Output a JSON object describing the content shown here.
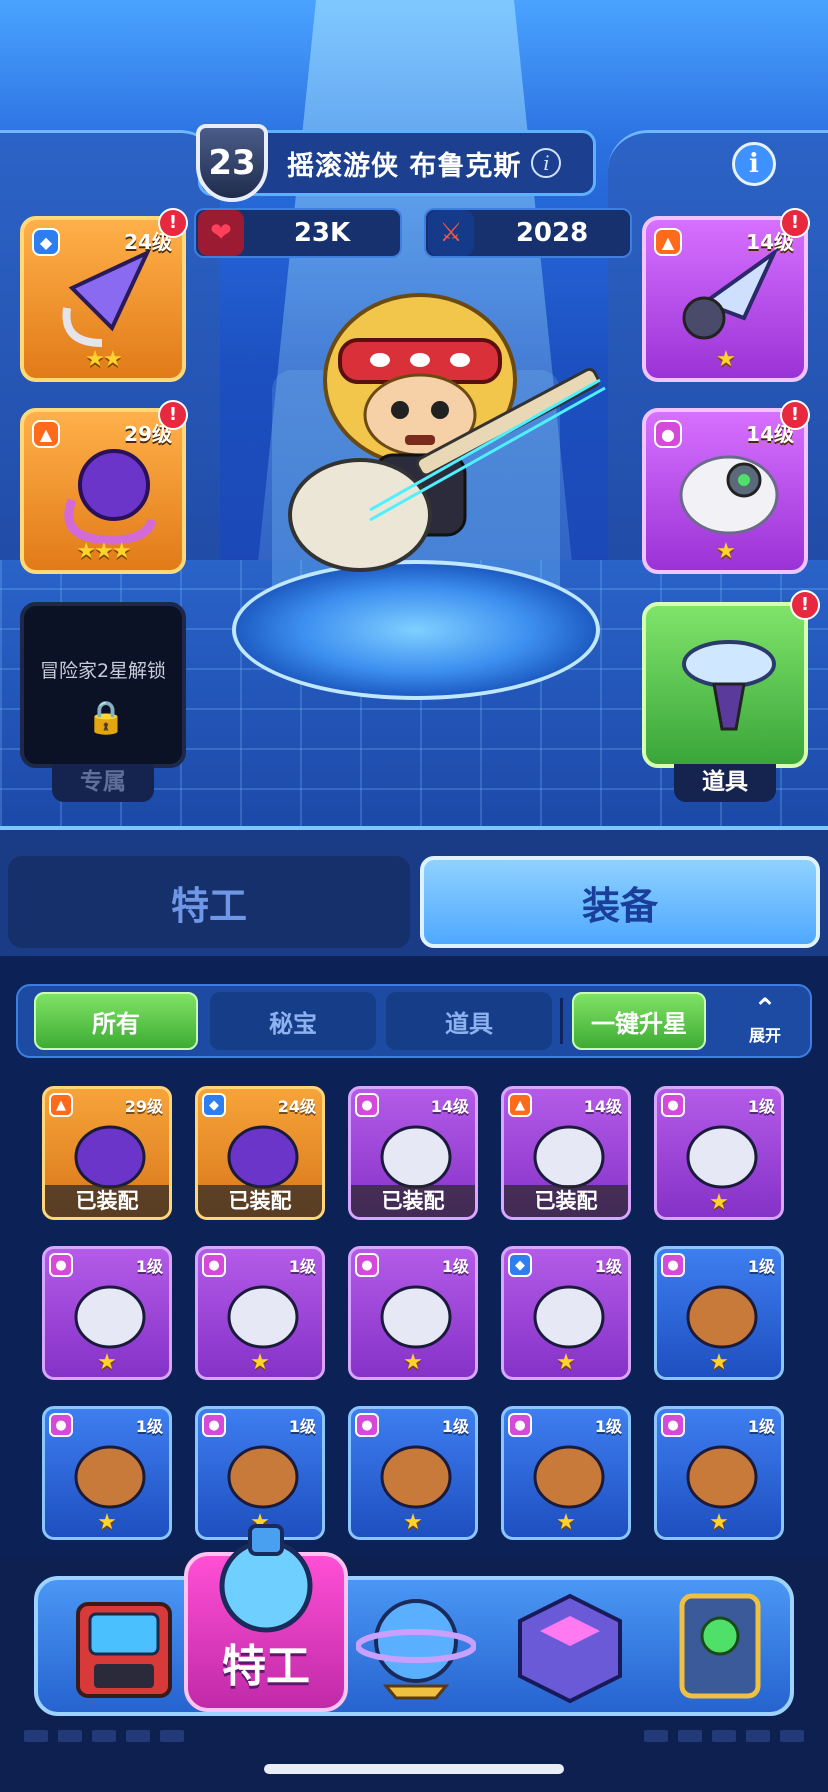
{
  "hero": {
    "level": "23",
    "name": "摇滚游侠 布鲁克斯",
    "hp": "23K",
    "attack": "2028"
  },
  "slots": {
    "left": [
      {
        "level": "24级",
        "stars": "★★",
        "badge": "shield-icon",
        "rarity": "orange"
      },
      {
        "level": "29级",
        "stars": "★★★",
        "badge": "fire-icon",
        "rarity": "orange"
      }
    ],
    "locked": {
      "text": "冒险家2星解锁",
      "caption": "专属"
    },
    "right": [
      {
        "level": "14级",
        "stars": "★",
        "badge": "fire-icon",
        "rarity": "purple"
      },
      {
        "level": "14级",
        "stars": "★",
        "badge": "orb-icon",
        "rarity": "purple"
      }
    ],
    "tool": {
      "caption": "道具"
    }
  },
  "tabs": {
    "agent": "特工",
    "equipment": "装备"
  },
  "filters": {
    "all": "所有",
    "secret": "秘宝",
    "tool": "道具",
    "upgrade_all": "一键升星",
    "expand": "展开"
  },
  "inventory": [
    {
      "level": "29级",
      "rarity": "orange",
      "badge": "fire",
      "status": "已装配"
    },
    {
      "level": "24级",
      "rarity": "orange",
      "badge": "shield",
      "status": "已装配"
    },
    {
      "level": "14级",
      "rarity": "purple",
      "badge": "orb",
      "status": "已装配"
    },
    {
      "level": "14级",
      "rarity": "purple",
      "badge": "fire",
      "status": "已装配"
    },
    {
      "level": "1级",
      "rarity": "purple",
      "badge": "orb",
      "stars": "★"
    },
    {
      "level": "1级",
      "rarity": "purple",
      "badge": "orb",
      "stars": "★"
    },
    {
      "level": "1级",
      "rarity": "purple",
      "badge": "orb",
      "stars": "★"
    },
    {
      "level": "1级",
      "rarity": "purple",
      "badge": "orb",
      "stars": "★"
    },
    {
      "level": "1级",
      "rarity": "purple",
      "badge": "shield",
      "stars": "★"
    },
    {
      "level": "1级",
      "rarity": "blue",
      "badge": "orb",
      "stars": "★"
    },
    {
      "level": "1级",
      "rarity": "blue",
      "badge": "orb",
      "stars": "★"
    },
    {
      "level": "1级",
      "rarity": "blue",
      "badge": "orb",
      "stars": "★"
    },
    {
      "level": "1级",
      "rarity": "blue",
      "badge": "orb",
      "stars": "★"
    },
    {
      "level": "1级",
      "rarity": "blue",
      "badge": "orb",
      "stars": "★"
    },
    {
      "level": "1级",
      "rarity": "blue",
      "badge": "orb",
      "stars": "★"
    }
  ],
  "nav": {
    "active_label": "特工"
  },
  "alert_mark": "!",
  "colors": {
    "accent": "#4fa8ff",
    "green": "#3eab35",
    "alert": "#e8283e",
    "star": "#ffd22e"
  }
}
